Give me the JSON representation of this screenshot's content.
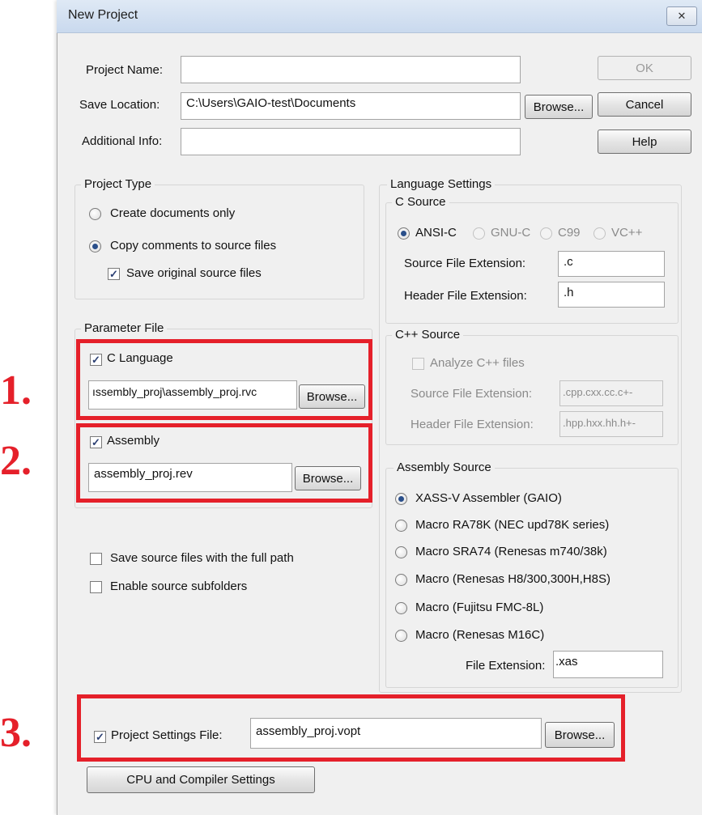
{
  "window": {
    "title": "New Project",
    "close_glyph": "✕"
  },
  "fields": {
    "project_name": {
      "label": "Project Name:",
      "value": ""
    },
    "save_location": {
      "label": "Save Location:",
      "value": "C:\\Users\\GAIO-test\\Documents",
      "browse": "Browse..."
    },
    "additional_info": {
      "label": "Additional Info:",
      "value": ""
    }
  },
  "buttons": {
    "ok": "OK",
    "cancel": "Cancel",
    "help": "Help",
    "cpu_settings": "CPU and Compiler Settings"
  },
  "project_type": {
    "title": "Project Type",
    "create_docs": "Create documents only",
    "copy_comments": "Copy comments to source files",
    "save_original": "Save original source files"
  },
  "parameter_file": {
    "title": "Parameter File",
    "c_language": {
      "label": "C Language",
      "value": "ıssembly_proj\\assembly_proj.rvc",
      "browse": "Browse..."
    },
    "assembly": {
      "label": "Assembly",
      "value": "assembly_proj.rev",
      "browse": "Browse..."
    }
  },
  "options": {
    "full_path": "Save source files with the full path",
    "subfolders": "Enable source subfolders"
  },
  "language_settings": {
    "title": "Language Settings",
    "c_source": {
      "title": "C Source",
      "ansi": "ANSI-C",
      "gnu": "GNU-C",
      "c99": "C99",
      "vcpp": "VC++",
      "src_ext_label": "Source File Extension:",
      "src_ext": ".c",
      "hdr_ext_label": "Header File Extension:",
      "hdr_ext": ".h"
    },
    "cpp_source": {
      "title": "C++ Source",
      "analyze": "Analyze C++ files",
      "src_ext_label": "Source File Extension:",
      "src_ext": ".cpp.cxx.cc.c+-",
      "hdr_ext_label": "Header File Extension:",
      "hdr_ext": ".hpp.hxx.hh.h+-"
    },
    "assembly_source": {
      "title": "Assembly Source",
      "opt1": "XASS-V Assembler (GAIO)",
      "opt2": "Macro RA78K (NEC upd78K series)",
      "opt3": "Macro SRA74 (Renesas m740/38k)",
      "opt4": "Macro (Renesas H8/300,300H,H8S)",
      "opt5": "Macro (Fujitsu FMC-8L)",
      "opt6": "Macro (Renesas M16C)",
      "file_ext_label": "File Extension:",
      "file_ext": ".xas"
    }
  },
  "project_settings": {
    "label": "Project Settings File:",
    "value": "assembly_proj.vopt",
    "browse": "Browse..."
  },
  "annotations": {
    "n1": "1.",
    "n2": "2.",
    "n3": "3.",
    "color": "#e5202a"
  },
  "check_glyph": "✓"
}
